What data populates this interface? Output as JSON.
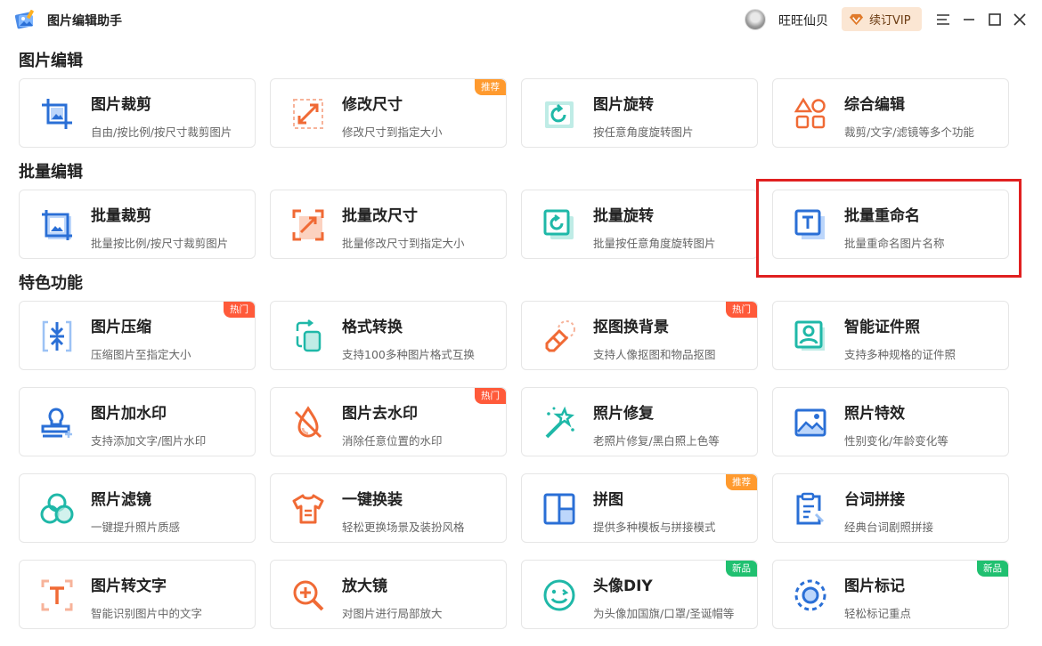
{
  "app": {
    "title": "图片编辑助手",
    "username": "旺旺仙贝",
    "vip_label": "续订VIP"
  },
  "sections": [
    {
      "title": "图片编辑"
    },
    {
      "title": "批量编辑"
    },
    {
      "title": "特色功能"
    }
  ],
  "cards": {
    "crop": {
      "title": "图片裁剪",
      "desc": "自由/按比例/按尺寸裁剪图片",
      "icon": "crop-icon"
    },
    "resize": {
      "title": "修改尺寸",
      "desc": "修改尺寸到指定大小",
      "badge": "推荐",
      "icon": "resize-icon"
    },
    "rotate": {
      "title": "图片旋转",
      "desc": "按任意角度旋转图片",
      "icon": "rotate-icon"
    },
    "combo": {
      "title": "综合编辑",
      "desc": "裁剪/文字/滤镜等多个功能",
      "icon": "shapes-icon"
    },
    "batch_crop": {
      "title": "批量裁剪",
      "desc": "批量按比例/按尺寸裁剪图片",
      "icon": "batch-crop-icon"
    },
    "batch_resize": {
      "title": "批量改尺寸",
      "desc": "批量修改尺寸到指定大小",
      "icon": "batch-resize-icon"
    },
    "batch_rotate": {
      "title": "批量旋转",
      "desc": "批量按任意角度旋转图片",
      "icon": "batch-rotate-icon"
    },
    "batch_rename": {
      "title": "批量重命名",
      "desc": "批量重命名图片名称",
      "icon": "rename-icon"
    },
    "compress": {
      "title": "图片压缩",
      "desc": "压缩图片至指定大小",
      "badge": "热门",
      "icon": "compress-icon"
    },
    "convert": {
      "title": "格式转换",
      "desc": "支持100多种图片格式互换",
      "icon": "convert-icon"
    },
    "cutout": {
      "title": "抠图换背景",
      "desc": "支持人像抠图和物品抠图",
      "badge": "热门",
      "icon": "eraser-icon"
    },
    "idphoto": {
      "title": "智能证件照",
      "desc": "支持多种规格的证件照",
      "icon": "id-photo-icon"
    },
    "watermark_add": {
      "title": "图片加水印",
      "desc": "支持添加文字/图片水印",
      "icon": "stamp-icon"
    },
    "watermark_remove": {
      "title": "图片去水印",
      "desc": "消除任意位置的水印",
      "badge": "热门",
      "icon": "drop-off-icon"
    },
    "restore": {
      "title": "照片修复",
      "desc": "老照片修复/黑白照上色等",
      "icon": "magic-wand-icon"
    },
    "effects": {
      "title": "照片特效",
      "desc": "性别变化/年龄变化等",
      "icon": "landscape-icon"
    },
    "filter": {
      "title": "照片滤镜",
      "desc": "一键提升照片质感",
      "icon": "filter-icon"
    },
    "outfit": {
      "title": "一键换装",
      "desc": "轻松更换场景及装扮风格",
      "icon": "shirt-icon"
    },
    "collage": {
      "title": "拼图",
      "desc": "提供多种模板与拼接模式",
      "badge": "推荐",
      "icon": "collage-icon"
    },
    "caption": {
      "title": "台词拼接",
      "desc": "经典台词剧照拼接",
      "icon": "clipboard-icon"
    },
    "ocr": {
      "title": "图片转文字",
      "desc": "智能识别图片中的文字",
      "icon": "ocr-icon"
    },
    "magnifier": {
      "title": "放大镜",
      "desc": "对图片进行局部放大",
      "icon": "magnifier-icon"
    },
    "avatar_diy": {
      "title": "头像DIY",
      "desc": "为头像加国旗/口罩/圣诞帽等",
      "badge": "新品",
      "icon": "smile-icon"
    },
    "marker": {
      "title": "图片标记",
      "desc": "轻松标记重点",
      "badge": "新品",
      "icon": "marker-icon"
    }
  },
  "colors": {
    "blue": "#2a6fd6",
    "orange": "#f06a35",
    "teal": "#1fb8a8",
    "highlight": "#e02020"
  }
}
